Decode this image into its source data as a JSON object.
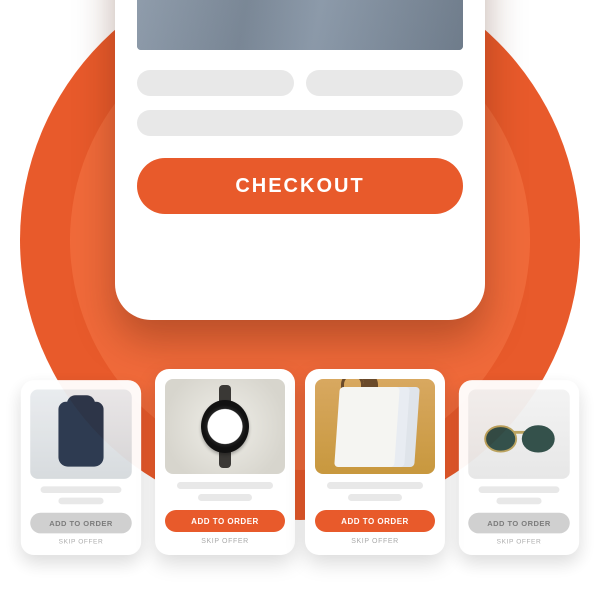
{
  "checkout": {
    "button_label": "CHECKOUT"
  },
  "offers": [
    {
      "add_label": "ADD TO ORDER",
      "skip_label": "SKIP OFFER",
      "variant": "grey",
      "thumb": "backpack"
    },
    {
      "add_label": "ADD TO ORDER",
      "skip_label": "SKIP OFFER",
      "variant": "orange",
      "thumb": "watch"
    },
    {
      "add_label": "ADD TO ORDER",
      "skip_label": "SKIP OFFER",
      "variant": "orange",
      "thumb": "shirts"
    },
    {
      "add_label": "ADD TO ORDER",
      "skip_label": "SKIP OFFER",
      "variant": "grey",
      "thumb": "sunglasses"
    }
  ]
}
